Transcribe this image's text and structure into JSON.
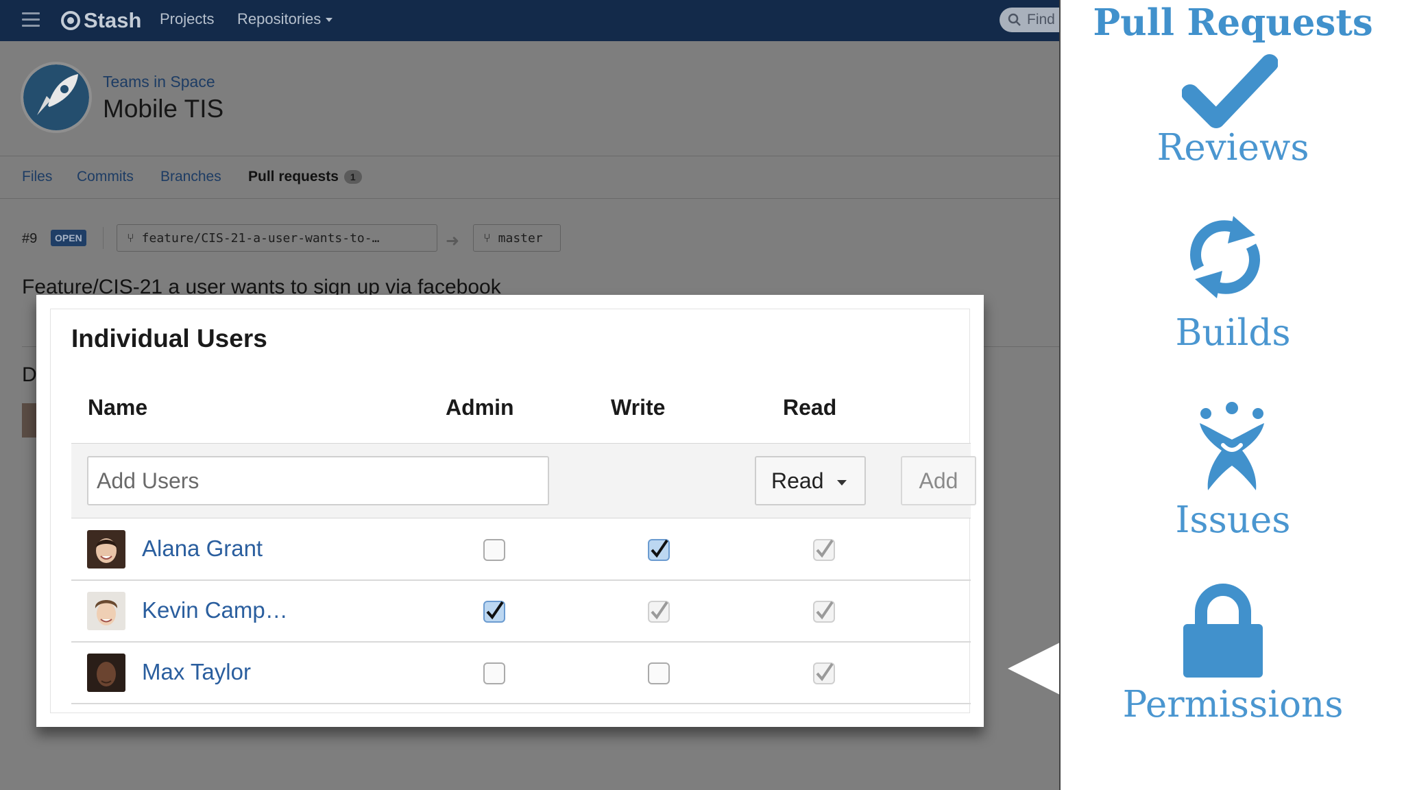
{
  "topnav": {
    "logo_text": "Stash",
    "projects_label": "Projects",
    "repositories_label": "Repositories",
    "find_placeholder": "Find"
  },
  "repo": {
    "project": "Teams in Space",
    "name": "Mobile TIS"
  },
  "tabs": {
    "files": "Files",
    "commits": "Commits",
    "branches": "Branches",
    "pull_requests": "Pull requests",
    "pull_requests_count": "1"
  },
  "pull_request": {
    "number": "#9",
    "state": "OPEN",
    "source_branch": "feature/CIS-21-a-user-wants-to-…",
    "target_branch": "master",
    "title": "Feature/CIS-21 a user wants to sign up via facebook",
    "section_initial": "D"
  },
  "permissions": {
    "title": "Individual Users",
    "columns": {
      "name": "Name",
      "admin": "Admin",
      "write": "Write",
      "read": "Read"
    },
    "add_users_placeholder": "Add Users",
    "selected_permission": "Read",
    "add_button": "Add",
    "users": [
      {
        "name": "Alana Grant",
        "admin": false,
        "write": true,
        "read": true
      },
      {
        "name": "Kevin Camp…",
        "admin": true,
        "write": true,
        "read": true
      },
      {
        "name": "Max Taylor",
        "admin": false,
        "write": false,
        "read": true
      }
    ]
  },
  "panel": {
    "title": "Pull Requests",
    "features": [
      {
        "label": "Reviews",
        "icon": "checkmark-icon"
      },
      {
        "label": "Builds",
        "icon": "refresh-icon"
      },
      {
        "label": "Issues",
        "icon": "jira-icon"
      },
      {
        "label": "Permissions",
        "icon": "lock-icon"
      }
    ],
    "accent_color": "#4191cc"
  }
}
